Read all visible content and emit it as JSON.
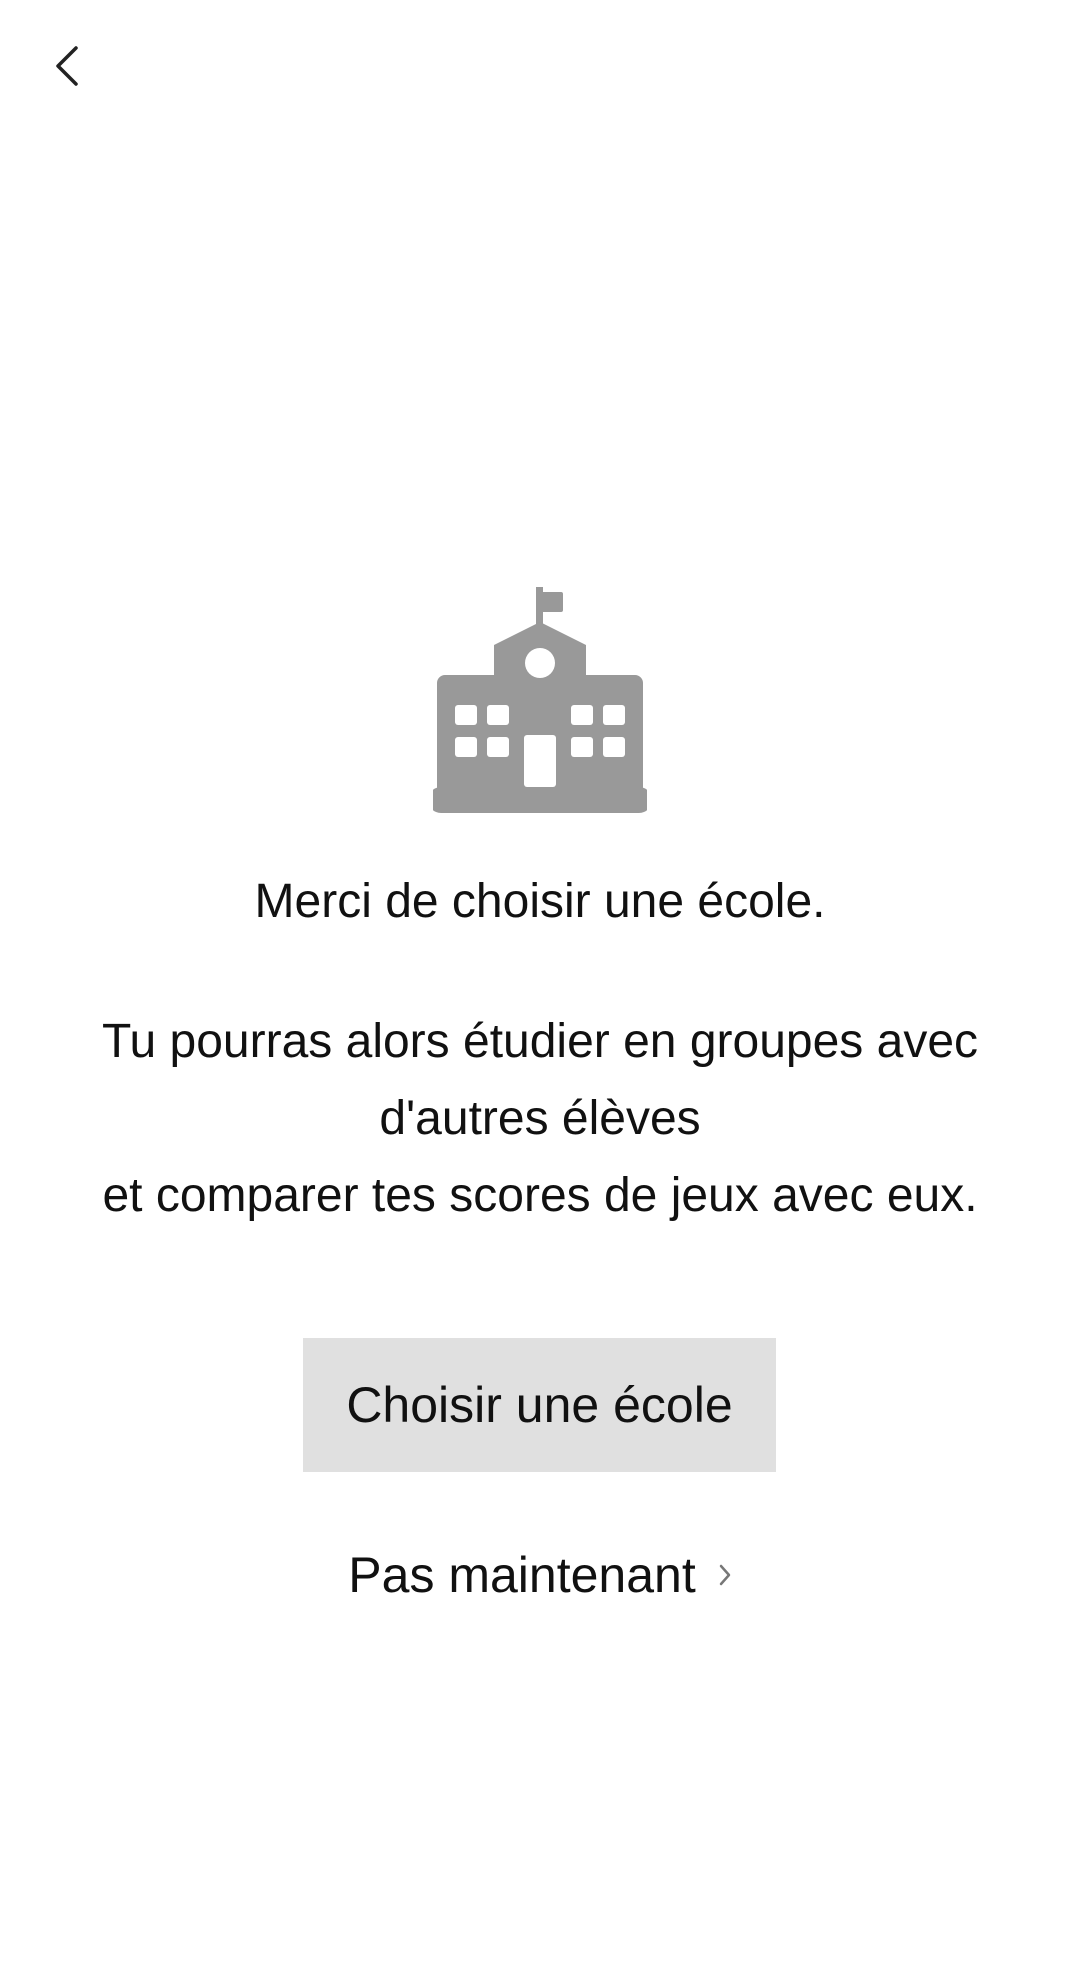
{
  "header": {
    "back_icon": "chevron-left-icon"
  },
  "main": {
    "illustration_icon": "school-building-icon",
    "illustration_color": "#999999",
    "prompt": "Merci de choisir une école.",
    "description_lines": [
      "Tu pourras alors étudier en groupes avec",
      "d'autres élèves",
      "et comparer tes scores de jeux avec eux."
    ],
    "primary_button_label": "Choisir une école",
    "primary_button_color": "#e0e0e0",
    "secondary_link_label": "Pas maintenant",
    "secondary_link_icon": "chevron-right-icon"
  }
}
